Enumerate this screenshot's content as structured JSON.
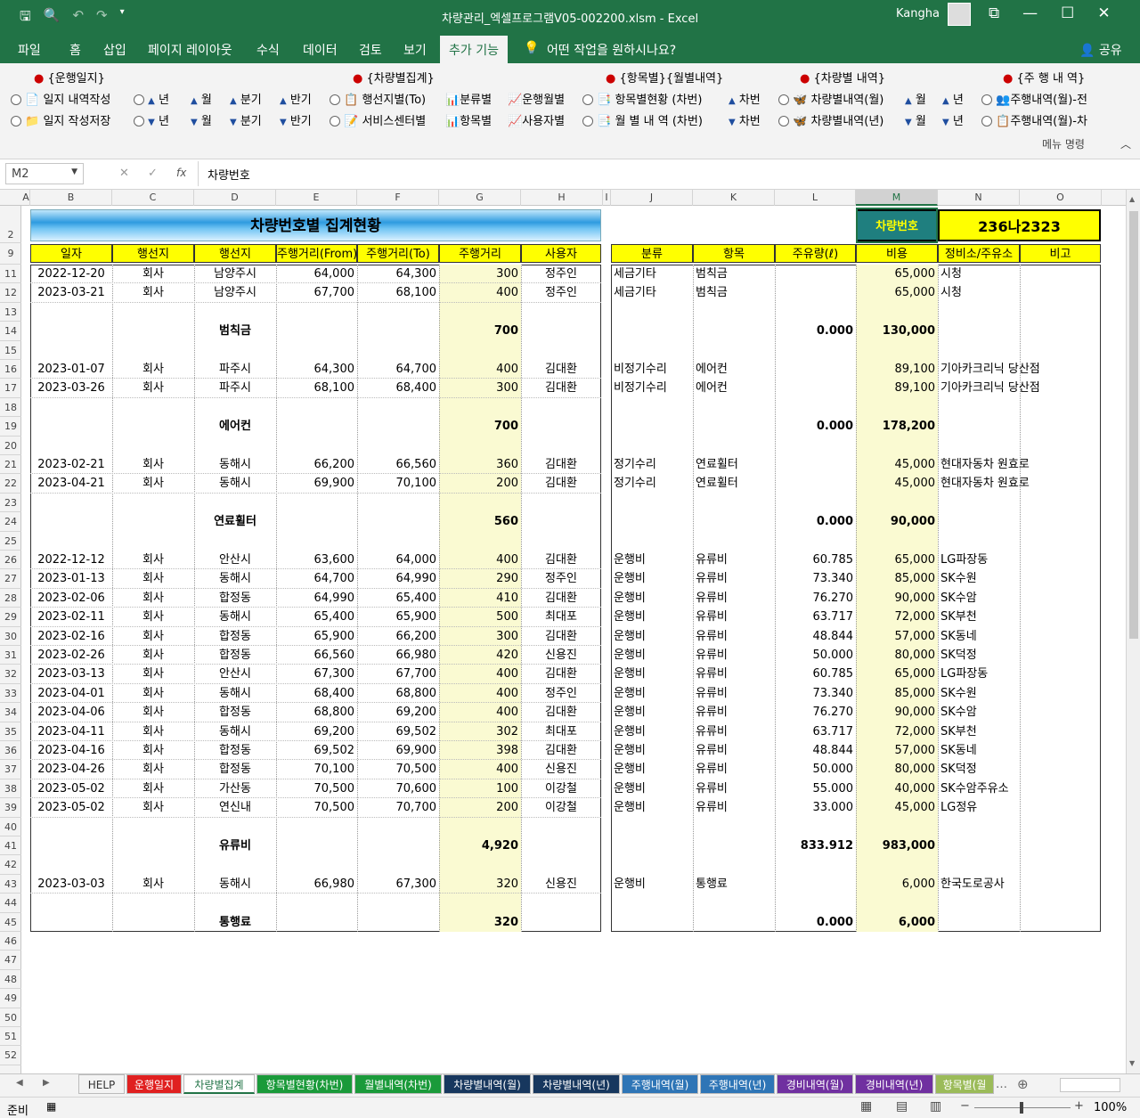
{
  "window": {
    "title": "차량관리_엑셀프로그램V05-002200.xlsm  -  Excel",
    "user": "Kangha"
  },
  "ribbon_tabs": [
    "파일",
    "홈",
    "삽입",
    "페이지 레이아웃",
    "수식",
    "데이터",
    "검토",
    "보기",
    "추가 기능"
  ],
  "tell_me": "어떤 작업을 원하시나요?",
  "share": "공유",
  "ribbon": {
    "groups": [
      "{운행일지}",
      "{차량별집계}",
      "{항목별}{월별내역}",
      "{차량별 내역}",
      "{주 행 내 역}"
    ],
    "row1": [
      "일지 내역작성",
      "년",
      "월",
      "분기",
      "반기",
      "행선지별(To)",
      "분류별",
      "운행월별",
      "항목별현황 (차번)",
      "차번",
      "차량별내역(월)",
      "월",
      "년",
      "주행내역(월)-전"
    ],
    "row2": [
      "일지 작성저장",
      "년",
      "월",
      "분기",
      "반기",
      "서비스센터별",
      "항목별",
      "사용자별",
      "월 별 내 역 (차번)",
      "차번",
      "차량별내역(년)",
      "월",
      "년",
      "주행내역(월)-차"
    ],
    "menu_cmd": "메뉴 명령"
  },
  "formula": {
    "namebox": "M2",
    "fx": "fx",
    "value": "차량번호"
  },
  "columns": [
    "A",
    "B",
    "C",
    "D",
    "E",
    "F",
    "G",
    "H",
    "I",
    "J",
    "K",
    "L",
    "M",
    "N",
    "O"
  ],
  "row_numbers": [
    "2",
    "9",
    "11",
    "12",
    "13",
    "14",
    "15",
    "16",
    "17",
    "18",
    "19",
    "20",
    "21",
    "22",
    "23",
    "24",
    "25",
    "26",
    "27",
    "28",
    "29",
    "30",
    "31",
    "32",
    "33",
    "34",
    "35",
    "36",
    "37",
    "38",
    "39",
    "40",
    "41",
    "42",
    "43",
    "44",
    "45",
    "46",
    "47",
    "48",
    "49",
    "50",
    "51",
    "52"
  ],
  "sheet": {
    "title": "차량번호별 집계현황",
    "car_label": "차량번호",
    "car_value": "236나2323",
    "left_headers": [
      "일자",
      "행선지",
      "행선지",
      "주행거리(From)",
      "주행거리(To)",
      "주행거리",
      "사용자"
    ],
    "right_headers": [
      "분류",
      "항목",
      "주유량(ℓ)",
      "비용",
      "정비소/주유소",
      "비고"
    ],
    "rows": [
      [
        "2022-12-20",
        "회사",
        "남양주시",
        "64,000",
        "64,300",
        "300",
        "정주인",
        "세금기타",
        "범칙금",
        "",
        "65,000",
        "시청"
      ],
      [
        "2023-03-21",
        "회사",
        "남양주시",
        "67,700",
        "68,100",
        "400",
        "정주인",
        "세금기타",
        "범칙금",
        "",
        "65,000",
        "시청"
      ],
      [
        "",
        "",
        "",
        "",
        "",
        "",
        "",
        "",
        "",
        "",
        "",
        ""
      ],
      [
        "",
        "",
        "범칙금",
        "",
        "",
        "700",
        "",
        "",
        "",
        "0.000",
        "130,000",
        ""
      ],
      [
        "",
        "",
        "",
        "",
        "",
        "",
        "",
        "",
        "",
        "",
        "",
        ""
      ],
      [
        "2023-01-07",
        "회사",
        "파주시",
        "64,300",
        "64,700",
        "400",
        "김대환",
        "비정기수리",
        "에어컨",
        "",
        "89,100",
        "기아카크리닉 당산점"
      ],
      [
        "2023-03-26",
        "회사",
        "파주시",
        "68,100",
        "68,400",
        "300",
        "김대환",
        "비정기수리",
        "에어컨",
        "",
        "89,100",
        "기아카크리닉 당산점"
      ],
      [
        "",
        "",
        "",
        "",
        "",
        "",
        "",
        "",
        "",
        "",
        "",
        ""
      ],
      [
        "",
        "",
        "에어컨",
        "",
        "",
        "700",
        "",
        "",
        "",
        "0.000",
        "178,200",
        ""
      ],
      [
        "",
        "",
        "",
        "",
        "",
        "",
        "",
        "",
        "",
        "",
        "",
        ""
      ],
      [
        "2023-02-21",
        "회사",
        "동해시",
        "66,200",
        "66,560",
        "360",
        "김대환",
        "정기수리",
        "연료휠터",
        "",
        "45,000",
        "현대자동차 원효로"
      ],
      [
        "2023-04-21",
        "회사",
        "동해시",
        "69,900",
        "70,100",
        "200",
        "김대환",
        "정기수리",
        "연료휠터",
        "",
        "45,000",
        "현대자동차 원효로"
      ],
      [
        "",
        "",
        "",
        "",
        "",
        "",
        "",
        "",
        "",
        "",
        "",
        ""
      ],
      [
        "",
        "",
        "연료휠터",
        "",
        "",
        "560",
        "",
        "",
        "",
        "0.000",
        "90,000",
        ""
      ],
      [
        "",
        "",
        "",
        "",
        "",
        "",
        "",
        "",
        "",
        "",
        "",
        ""
      ],
      [
        "2022-12-12",
        "회사",
        "안산시",
        "63,600",
        "64,000",
        "400",
        "김대환",
        "운행비",
        "유류비",
        "60.785",
        "65,000",
        "LG파장동"
      ],
      [
        "2023-01-13",
        "회사",
        "동해시",
        "64,700",
        "64,990",
        "290",
        "정주인",
        "운행비",
        "유류비",
        "73.340",
        "85,000",
        "SK수원"
      ],
      [
        "2023-02-06",
        "회사",
        "합정동",
        "64,990",
        "65,400",
        "410",
        "김대환",
        "운행비",
        "유류비",
        "76.270",
        "90,000",
        "SK수암"
      ],
      [
        "2023-02-11",
        "회사",
        "동해시",
        "65,400",
        "65,900",
        "500",
        "최대포",
        "운행비",
        "유류비",
        "63.717",
        "72,000",
        "SK부천"
      ],
      [
        "2023-02-16",
        "회사",
        "합정동",
        "65,900",
        "66,200",
        "300",
        "김대환",
        "운행비",
        "유류비",
        "48.844",
        "57,000",
        "SK동네"
      ],
      [
        "2023-02-26",
        "회사",
        "합정동",
        "66,560",
        "66,980",
        "420",
        "신용진",
        "운행비",
        "유류비",
        "50.000",
        "80,000",
        "SK덕정"
      ],
      [
        "2023-03-13",
        "회사",
        "안산시",
        "67,300",
        "67,700",
        "400",
        "김대환",
        "운행비",
        "유류비",
        "60.785",
        "65,000",
        "LG파장동"
      ],
      [
        "2023-04-01",
        "회사",
        "동해시",
        "68,400",
        "68,800",
        "400",
        "정주인",
        "운행비",
        "유류비",
        "73.340",
        "85,000",
        "SK수원"
      ],
      [
        "2023-04-06",
        "회사",
        "합정동",
        "68,800",
        "69,200",
        "400",
        "김대환",
        "운행비",
        "유류비",
        "76.270",
        "90,000",
        "SK수암"
      ],
      [
        "2023-04-11",
        "회사",
        "동해시",
        "69,200",
        "69,502",
        "302",
        "최대포",
        "운행비",
        "유류비",
        "63.717",
        "72,000",
        "SK부천"
      ],
      [
        "2023-04-16",
        "회사",
        "합정동",
        "69,502",
        "69,900",
        "398",
        "김대환",
        "운행비",
        "유류비",
        "48.844",
        "57,000",
        "SK동네"
      ],
      [
        "2023-04-26",
        "회사",
        "합정동",
        "70,100",
        "70,500",
        "400",
        "신용진",
        "운행비",
        "유류비",
        "50.000",
        "80,000",
        "SK덕정"
      ],
      [
        "2023-05-02",
        "회사",
        "가산동",
        "70,500",
        "70,600",
        "100",
        "이강철",
        "운행비",
        "유류비",
        "55.000",
        "40,000",
        "SK수암주유소"
      ],
      [
        "2023-05-02",
        "회사",
        "연신내",
        "70,500",
        "70,700",
        "200",
        "이강철",
        "운행비",
        "유류비",
        "33.000",
        "45,000",
        "LG정유"
      ],
      [
        "",
        "",
        "",
        "",
        "",
        "",
        "",
        "",
        "",
        "",
        "",
        ""
      ],
      [
        "",
        "",
        "유류비",
        "",
        "",
        "4,920",
        "",
        "",
        "",
        "833.912",
        "983,000",
        ""
      ],
      [
        "",
        "",
        "",
        "",
        "",
        "",
        "",
        "",
        "",
        "",
        "",
        ""
      ],
      [
        "2023-03-03",
        "회사",
        "동해시",
        "66,980",
        "67,300",
        "320",
        "신용진",
        "운행비",
        "통행료",
        "",
        "6,000",
        "한국도로공사"
      ],
      [
        "",
        "",
        "",
        "",
        "",
        "",
        "",
        "",
        "",
        "",
        "",
        ""
      ],
      [
        "",
        "",
        "통행료",
        "",
        "",
        "320",
        "",
        "",
        "",
        "0.000",
        "6,000",
        ""
      ]
    ]
  },
  "sheet_tabs": [
    {
      "label": "HELP",
      "color": "#f3f3f3",
      "fg": "#333"
    },
    {
      "label": "운행일지",
      "color": "#e02020",
      "fg": "#fff"
    },
    {
      "label": "차량별집계",
      "color": "#ffffff",
      "fg": "#217346"
    },
    {
      "label": "항목별현황(차번)",
      "color": "#1a9a3a",
      "fg": "#fff"
    },
    {
      "label": "월별내역(차번)",
      "color": "#1a9a3a",
      "fg": "#fff"
    },
    {
      "label": "차량별내역(월)",
      "color": "#17375e",
      "fg": "#fff"
    },
    {
      "label": "차량별내역(년)",
      "color": "#17375e",
      "fg": "#fff"
    },
    {
      "label": "주행내역(월)",
      "color": "#2e75b6",
      "fg": "#fff"
    },
    {
      "label": "주행내역(년)",
      "color": "#2e75b6",
      "fg": "#fff"
    },
    {
      "label": "경비내역(월)",
      "color": "#7030a0",
      "fg": "#fff"
    },
    {
      "label": "경비내역(년)",
      "color": "#7030a0",
      "fg": "#fff"
    },
    {
      "label": "항목별(월",
      "color": "#9bbb59",
      "fg": "#fff"
    }
  ],
  "status": {
    "ready": "준비",
    "zoom": "100%"
  }
}
